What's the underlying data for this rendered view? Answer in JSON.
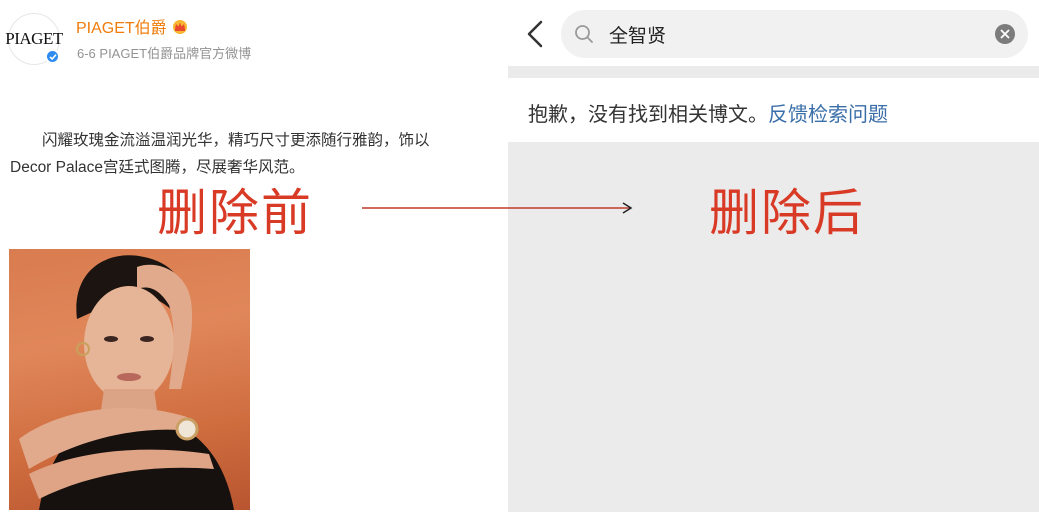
{
  "left_panel": {
    "avatar_logo": "PIAGET",
    "username": "PIAGET伯爵",
    "crown_icon": "crown-icon",
    "verified_icon": "verified-badge-icon",
    "meta": "6-6  PIAGET伯爵品牌官方微博",
    "post_line1": "闪耀玫瑰金流溢温润光华，精巧尺寸更添随行雅韵，饰以",
    "post_line2": "Decor Palace宫廷式图腾，尽展奢华风范。"
  },
  "right_panel": {
    "back_icon": "chevron-left-icon",
    "search_icon": "search-icon",
    "search_value": "全智贤",
    "clear_icon": "clear-circle-icon",
    "message": "抱歉，没有找到相关博文。",
    "feedback_link": "反馈检索问题"
  },
  "annotations": {
    "before_label": "删除前",
    "after_label": "删除后",
    "arrow_icon": "arrow-right-icon"
  },
  "colors": {
    "username": "#f07c0b",
    "link": "#3a6ea8",
    "annotation": "#d83a26",
    "verified": "#2d8cf0",
    "gray_bg": "#ebebeb"
  }
}
